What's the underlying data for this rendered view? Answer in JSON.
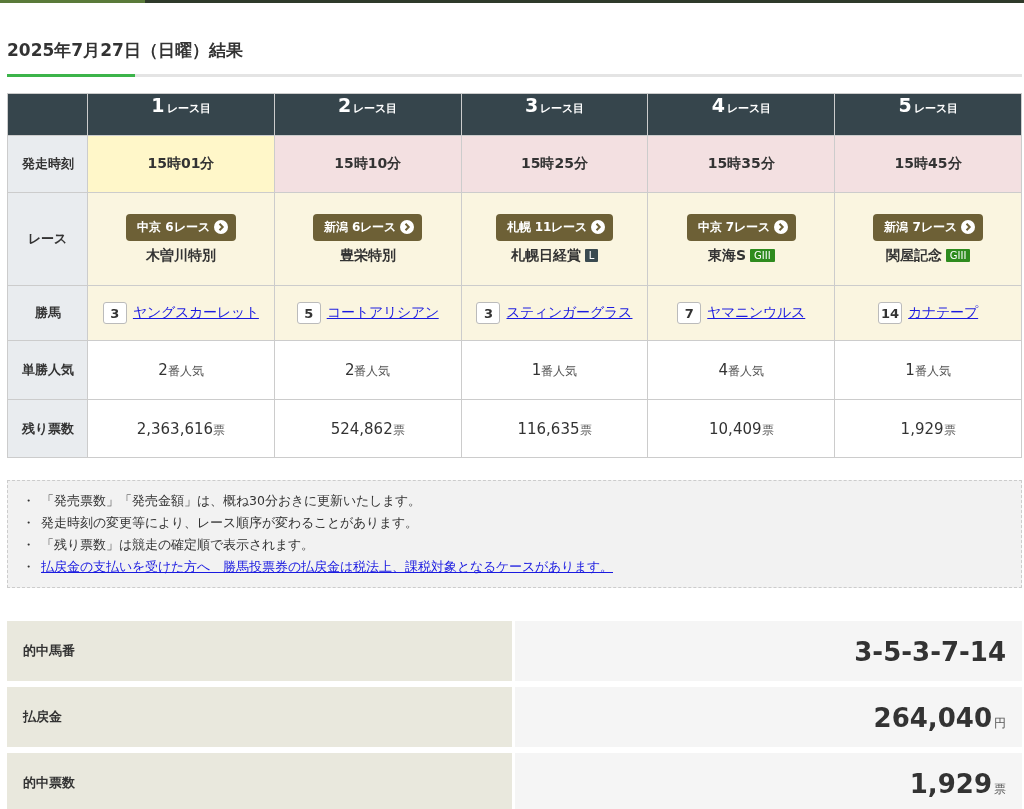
{
  "title": "2025年7月27日（日曜）結果",
  "row_labels": [
    "発走時刻",
    "レース",
    "勝馬",
    "単勝人気",
    "残り票数"
  ],
  "races": [
    {
      "number": "1",
      "suffix": "レース目",
      "selected": true,
      "time": "15時01分",
      "venue": "中京 6レース",
      "name": "木曽川特別",
      "horse_number": "3",
      "horse": "ヤングスカーレット",
      "popularity": "2",
      "popularity_unit": "番人気",
      "remaining": "2,363,616",
      "remaining_unit": "票"
    },
    {
      "number": "2",
      "suffix": "レース目",
      "selected": false,
      "time": "15時10分",
      "venue": "新潟 6レース",
      "name": "豊栄特別",
      "horse_number": "5",
      "horse": "コートアリシアン",
      "popularity": "2",
      "popularity_unit": "番人気",
      "remaining": "524,862",
      "remaining_unit": "票"
    },
    {
      "number": "3",
      "suffix": "レース目",
      "selected": false,
      "time": "15時25分",
      "venue": "札幌 11レース",
      "name": "札幌日経賞",
      "grade": {
        "label": "L",
        "color": "#3a4a50"
      },
      "horse_number": "3",
      "horse": "スティンガーグラス",
      "popularity": "1",
      "popularity_unit": "番人気",
      "remaining": "116,635",
      "remaining_unit": "票"
    },
    {
      "number": "4",
      "suffix": "レース目",
      "selected": false,
      "time": "15時35分",
      "venue": "中京 7レース",
      "name": "東海S",
      "grade": {
        "label": "GIII",
        "color": "#2e8b1e"
      },
      "horse_number": "7",
      "horse": "ヤマニンウルス",
      "popularity": "4",
      "popularity_unit": "番人気",
      "remaining": "10,409",
      "remaining_unit": "票"
    },
    {
      "number": "5",
      "suffix": "レース目",
      "selected": false,
      "time": "15時45分",
      "venue": "新潟 7レース",
      "name": "関屋記念",
      "grade": {
        "label": "GIII",
        "color": "#2e8b1e"
      },
      "horse_number": "14",
      "horse": "カナテープ",
      "popularity": "1",
      "popularity_unit": "番人気",
      "remaining": "1,929",
      "remaining_unit": "票"
    }
  ],
  "notes": [
    {
      "kind": "text",
      "bullet": "・",
      "text": "「発売票数」「発売金額」は、概ね30分おきに更新いたします。"
    },
    {
      "kind": "text",
      "bullet": "・",
      "text": "発走時刻の変更等により、レース順序が変わることがあります。"
    },
    {
      "kind": "text",
      "bullet": "・",
      "text": "「残り票数」は競走の確定順で表示されます。"
    },
    {
      "kind": "link",
      "bullet": "・",
      "text": "払戻金の支払いを受けた方へ　勝馬投票券の払戻金は税法上、課税対象となるケースがあります。"
    }
  ],
  "summary": [
    {
      "label": "的中馬番",
      "value": "3-5-3-7-14"
    },
    {
      "label": "払戻金",
      "value": "264,040",
      "unit": "円"
    },
    {
      "label": "的中票数",
      "value": "1,929",
      "unit": "票"
    }
  ]
}
